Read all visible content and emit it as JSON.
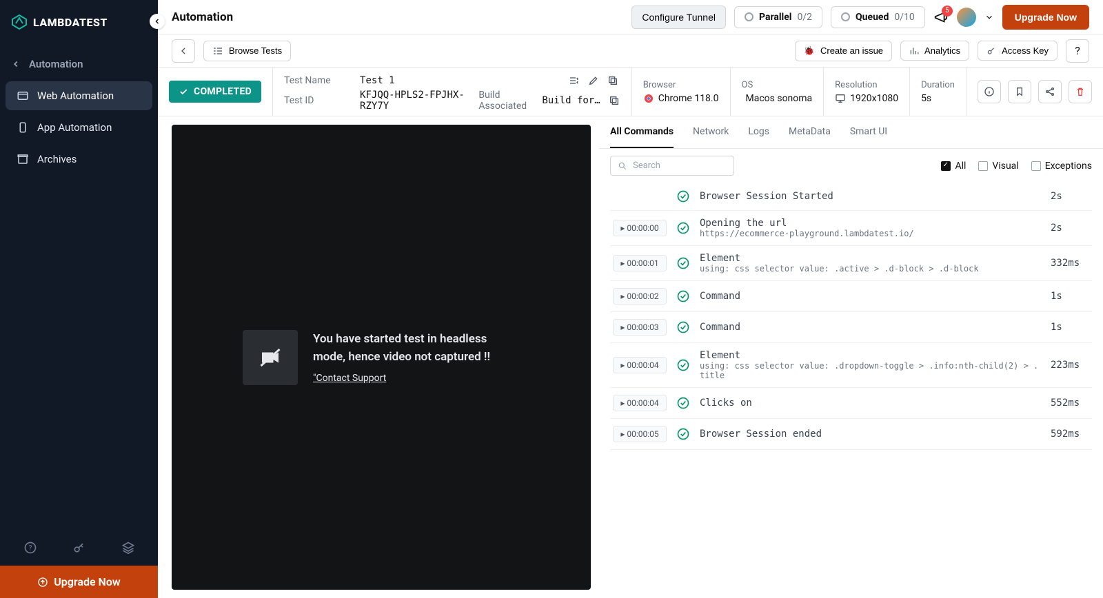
{
  "brand": "LAMBDATEST",
  "header": {
    "title": "Automation",
    "configure_tunnel": "Configure Tunnel",
    "parallel": {
      "label": "Parallel",
      "value": "0/2"
    },
    "queued": {
      "label": "Queued",
      "value": "0/10"
    },
    "notifications": "5",
    "upgrade": "Upgrade Now"
  },
  "sidebar": {
    "section_label": "Automation",
    "items": [
      {
        "label": "Web Automation"
      },
      {
        "label": "App Automation"
      },
      {
        "label": "Archives"
      }
    ],
    "upgrade": "Upgrade Now"
  },
  "toolbar": {
    "browse_tests": "Browse Tests",
    "create_issue": "Create an issue",
    "analytics": "Analytics",
    "access_key": "Access Key"
  },
  "test": {
    "name_label": "Test Name",
    "name_value": "Test 1",
    "id_label": "Test ID",
    "id_value": "KFJQQ-HPLS2-FPJHX-RZY7Y",
    "build_label": "Build Associated",
    "build_value": "Build for He…",
    "status": "COMPLETED",
    "browser_label": "Browser",
    "browser_value": "Chrome 118.0",
    "os_label": "OS",
    "os_value": "Macos sonoma",
    "resolution_label": "Resolution",
    "resolution_value": "1920x1080",
    "duration_label": "Duration",
    "duration_value": "5s"
  },
  "video": {
    "headline": "You have started test in headless mode, hence video not captured !!",
    "contact": "\"Contact Support"
  },
  "tabs": [
    "All Commands",
    "Network",
    "Logs",
    "MetaData",
    "Smart UI"
  ],
  "filters": {
    "search_placeholder": "Search",
    "all": "All",
    "visual": "Visual",
    "exceptions": "Exceptions"
  },
  "commands": [
    {
      "time": "",
      "title": "Browser Session Started",
      "sub": "",
      "dur": "2s"
    },
    {
      "time": "00:00:00",
      "title": "Opening the url",
      "sub": "https://ecommerce-playground.lambdatest.io/",
      "dur": "2s"
    },
    {
      "time": "00:00:01",
      "title": "Element",
      "sub": "using: css selector value: .active > .d-block > .d-block",
      "dur": "332ms"
    },
    {
      "time": "00:00:02",
      "title": "Command",
      "sub": "",
      "dur": "1s"
    },
    {
      "time": "00:00:03",
      "title": "Command",
      "sub": "",
      "dur": "1s"
    },
    {
      "time": "00:00:04",
      "title": "Element",
      "sub": "using: css selector value: .dropdown-toggle > .info:nth-child(2) > .title",
      "dur": "223ms"
    },
    {
      "time": "00:00:04",
      "title": "Clicks on",
      "sub": "",
      "dur": "552ms"
    },
    {
      "time": "00:00:05",
      "title": "Browser Session ended",
      "sub": "",
      "dur": "592ms"
    }
  ]
}
